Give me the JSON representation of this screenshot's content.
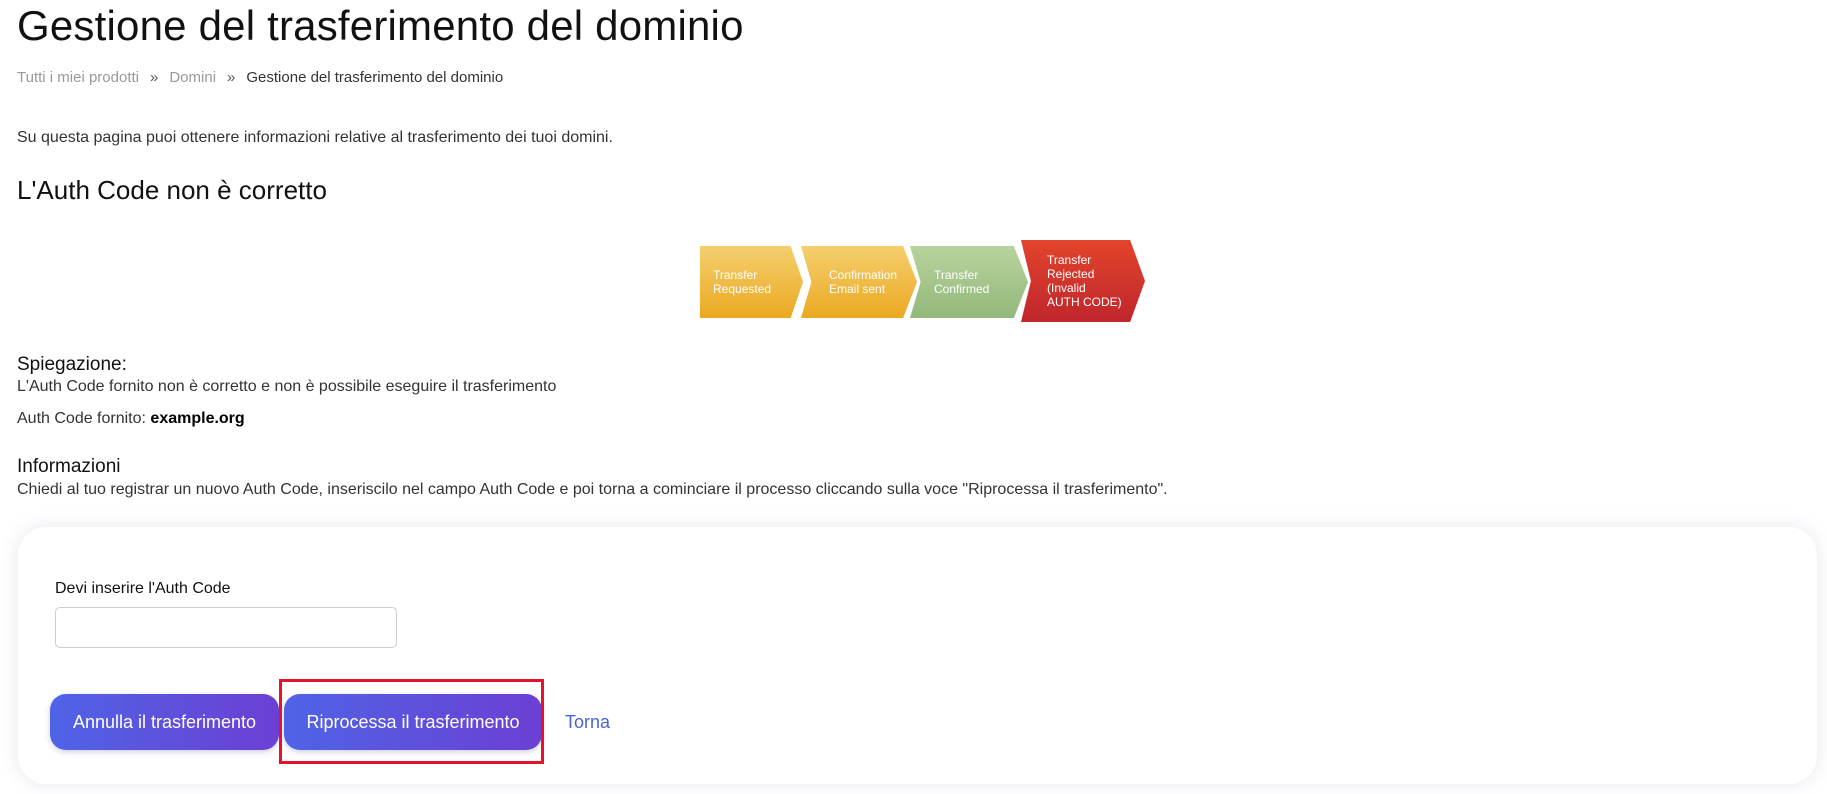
{
  "page": {
    "title": "Gestione del trasferimento del dominio",
    "intro": "Su questa pagina puoi ottenere informazioni relative al trasferimento dei tuoi domini.",
    "status_heading": "L'Auth Code non è corretto"
  },
  "breadcrumb": {
    "items": [
      "Tutti i miei prodotti",
      "Domini",
      "Gestione del trasferimento del dominio"
    ],
    "separator": "»"
  },
  "steps": [
    {
      "lines": [
        "Transfer",
        "Requested"
      ],
      "color": "#eba821",
      "state": "done"
    },
    {
      "lines": [
        "Confirmation",
        "Email sent"
      ],
      "color": "#eba821",
      "state": "done"
    },
    {
      "lines": [
        "Transfer",
        "Confirmed"
      ],
      "color": "#93b87a",
      "state": "done"
    },
    {
      "lines": [
        "Transfer",
        "Rejected",
        "(Invalid",
        "AUTH CODE)"
      ],
      "color": "#c0262c",
      "state": "current"
    }
  ],
  "explanation": {
    "label": "Spiegazione:",
    "text": "L'Auth Code fornito non è corretto e non è possibile eseguire il trasferimento",
    "auth_label": "Auth Code fornito:",
    "auth_value": "example.org"
  },
  "info": {
    "label": "Informazioni",
    "text": "Chiedi al tuo registrar un nuovo Auth Code, inseriscilo nel campo Auth Code e poi torna a cominciare il processo cliccando sulla voce \"Riprocessa il trasferimento\"."
  },
  "form": {
    "field_label": "Devi inserire l'Auth Code",
    "auth_input_value": "",
    "auth_input_placeholder": ""
  },
  "actions": {
    "cancel_label": "Annulla il trasferimento",
    "reprocess_label": "Riprocessa il trasferimento",
    "back_label": "Torna"
  },
  "colors": {
    "button_gradient_start": "#4f63e6",
    "button_gradient_end": "#6c3fd4",
    "link": "#4a63d9",
    "highlight": "#e3132b"
  }
}
